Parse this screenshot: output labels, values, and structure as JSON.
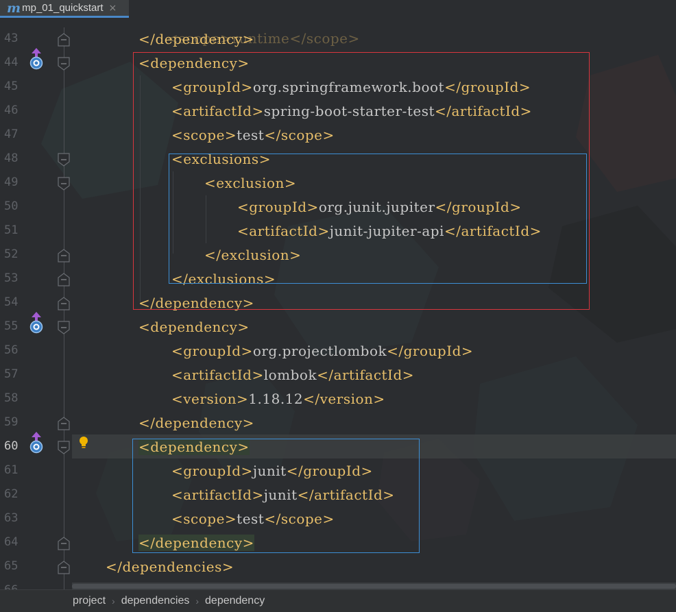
{
  "tab": {
    "icon": "maven-m-icon",
    "icon_glyph": "m",
    "label": "mp_01_quickstart",
    "close_glyph": "×"
  },
  "editor": {
    "current_line": 60,
    "lines": [
      {
        "no": "43",
        "indent": 1,
        "parts": [
          {
            "t": "tag",
            "v": "</dependency>"
          }
        ]
      },
      {
        "no": "44",
        "indent": 1,
        "parts": [
          {
            "t": "tag",
            "v": "<dependency>"
          }
        ]
      },
      {
        "no": "45",
        "indent": 2,
        "parts": [
          {
            "t": "tag",
            "v": "<groupId>"
          },
          {
            "t": "txt",
            "v": "org.springframework.boot"
          },
          {
            "t": "tag",
            "v": "</groupId>"
          }
        ]
      },
      {
        "no": "46",
        "indent": 2,
        "parts": [
          {
            "t": "tag",
            "v": "<artifactId>"
          },
          {
            "t": "txt",
            "v": "spring-boot-starter-test"
          },
          {
            "t": "tag",
            "v": "</artifactId>"
          }
        ]
      },
      {
        "no": "47",
        "indent": 2,
        "parts": [
          {
            "t": "tag",
            "v": "<scope>"
          },
          {
            "t": "txt",
            "v": "test"
          },
          {
            "t": "tag",
            "v": "</scope>"
          }
        ]
      },
      {
        "no": "48",
        "indent": 2,
        "parts": [
          {
            "t": "tag",
            "v": "<exclusions>"
          }
        ]
      },
      {
        "no": "49",
        "indent": 3,
        "parts": [
          {
            "t": "tag",
            "v": "<exclusion>"
          }
        ]
      },
      {
        "no": "50",
        "indent": 4,
        "parts": [
          {
            "t": "tag",
            "v": "<groupId>"
          },
          {
            "t": "txt",
            "v": "org.junit.jupiter"
          },
          {
            "t": "tag",
            "v": "</groupId>"
          }
        ]
      },
      {
        "no": "51",
        "indent": 4,
        "parts": [
          {
            "t": "tag",
            "v": "<artifactId>"
          },
          {
            "t": "txt",
            "v": "junit-jupiter-api"
          },
          {
            "t": "tag",
            "v": "</artifactId>"
          }
        ]
      },
      {
        "no": "52",
        "indent": 3,
        "parts": [
          {
            "t": "tag",
            "v": "</exclusion>"
          }
        ]
      },
      {
        "no": "53",
        "indent": 2,
        "parts": [
          {
            "t": "tag",
            "v": "</exclusions>"
          }
        ]
      },
      {
        "no": "54",
        "indent": 1,
        "parts": [
          {
            "t": "tag",
            "v": "</dependency>"
          }
        ]
      },
      {
        "no": "55",
        "indent": 1,
        "parts": [
          {
            "t": "tag",
            "v": "<dependency>"
          }
        ]
      },
      {
        "no": "56",
        "indent": 2,
        "parts": [
          {
            "t": "tag",
            "v": "<groupId>"
          },
          {
            "t": "txt",
            "v": "org.projectlombok"
          },
          {
            "t": "tag",
            "v": "</groupId>"
          }
        ]
      },
      {
        "no": "57",
        "indent": 2,
        "parts": [
          {
            "t": "tag",
            "v": "<artifactId>"
          },
          {
            "t": "txt",
            "v": "lombok"
          },
          {
            "t": "tag",
            "v": "</artifactId>"
          }
        ]
      },
      {
        "no": "58",
        "indent": 2,
        "parts": [
          {
            "t": "tag",
            "v": "<version>"
          },
          {
            "t": "txt",
            "v": "1.18.12"
          },
          {
            "t": "tag",
            "v": "</version>"
          }
        ]
      },
      {
        "no": "59",
        "indent": 1,
        "parts": [
          {
            "t": "tag",
            "v": "</dependency>"
          }
        ]
      },
      {
        "no": "60",
        "indent": 1,
        "hl": true,
        "parts": [
          {
            "t": "tag",
            "v": "<dependency>"
          }
        ]
      },
      {
        "no": "61",
        "indent": 2,
        "parts": [
          {
            "t": "tag",
            "v": "<groupId>"
          },
          {
            "t": "txt",
            "v": "junit"
          },
          {
            "t": "tag",
            "v": "</groupId>"
          }
        ]
      },
      {
        "no": "62",
        "indent": 2,
        "parts": [
          {
            "t": "tag",
            "v": "<artifactId>"
          },
          {
            "t": "txt",
            "v": "junit"
          },
          {
            "t": "tag",
            "v": "</artifactId>"
          }
        ]
      },
      {
        "no": "63",
        "indent": 2,
        "parts": [
          {
            "t": "tag",
            "v": "<scope>"
          },
          {
            "t": "txt",
            "v": "test"
          },
          {
            "t": "tag",
            "v": "</scope>"
          }
        ]
      },
      {
        "no": "64",
        "indent": 1,
        "hl": true,
        "parts": [
          {
            "t": "tag",
            "v": "</dependency>"
          }
        ]
      },
      {
        "no": "65",
        "indent": 0,
        "parts": [
          {
            "t": "tag",
            "v": "</dependencies>"
          }
        ]
      }
    ],
    "partial_top_line": "<scope>runtime</scope>",
    "partial_bottom_line_no": "66",
    "fold_marker_lines": [
      "43",
      "44",
      "48",
      "49",
      "52",
      "53",
      "54",
      "55",
      "59",
      "60",
      "64",
      "65"
    ],
    "override_icon_lines": [
      "44",
      "55",
      "60"
    ],
    "bulb_line": "60"
  },
  "breadcrumb": {
    "items": [
      "project",
      "dependencies",
      "dependency"
    ],
    "separator": "›"
  },
  "colors": {
    "tag": "#e8bf6a",
    "text": "#c8c8c8",
    "red_box": "#d9363e",
    "blue_box": "#3d8fd6",
    "tab_underline": "#4a88c7"
  }
}
